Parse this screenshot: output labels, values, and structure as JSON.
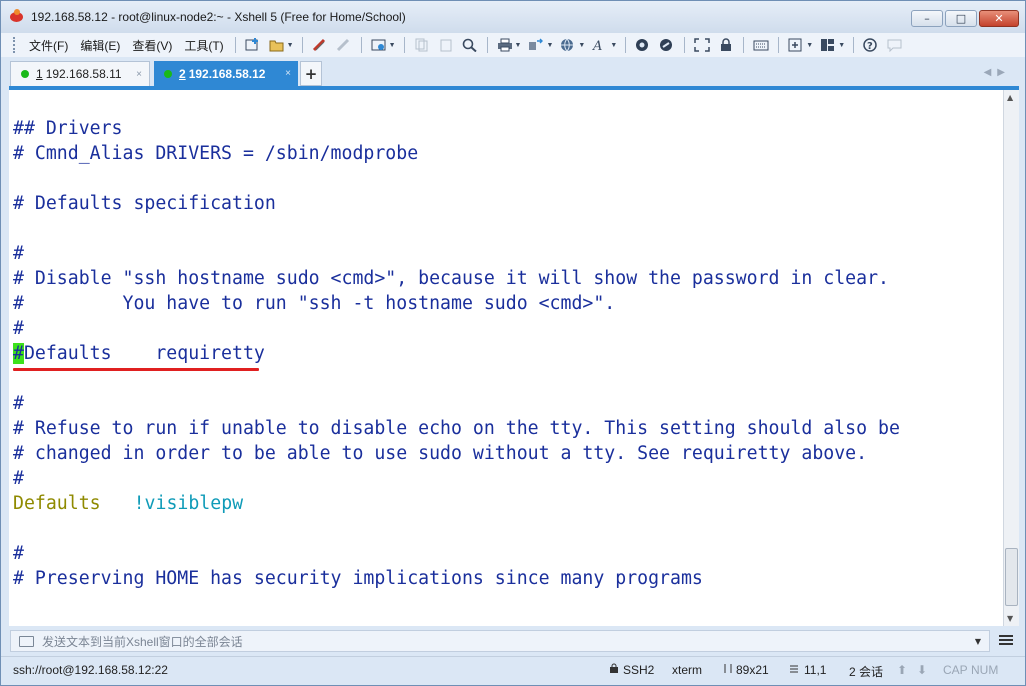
{
  "window": {
    "title": "192.168.58.12 - root@linux-node2:~ - Xshell 5 (Free for Home/School)",
    "minimize_label": "–",
    "maximize_label": "□",
    "close_label": "✕"
  },
  "menu": {
    "file": "文件(F)",
    "edit": "编辑(E)",
    "view": "查看(V)",
    "tools": "工具(T)"
  },
  "tabs": [
    {
      "number": "1",
      "label": "192.168.58.11"
    },
    {
      "number": "2",
      "label": "192.168.58.12"
    }
  ],
  "tab_close_glyph": "×",
  "tab_add_glyph": "+",
  "terminal": {
    "lines": [
      "## Drivers",
      "# Cmnd_Alias DRIVERS = /sbin/modprobe",
      "",
      "# Defaults specification",
      "",
      "#",
      "# Disable \"ssh hostname sudo <cmd>\", because it will show the password in clear.",
      "#         You have to run \"ssh -t hostname sudo <cmd>\".",
      "#",
      "#",
      "Defaults    requiretty",
      "",
      "#",
      "# Refuse to run if unable to disable echo on the tty. This setting should also be",
      "# changed in order to be able to use sudo without a tty. See requiretty above.",
      "#",
      "Defaults",
      "!visiblepw",
      "",
      "#",
      "# Preserving HOME has security implications since many programs"
    ]
  },
  "compose": {
    "placeholder": "发送文本到当前Xshell窗口的全部会话"
  },
  "status": {
    "connection": "ssh://root@192.168.58.12:22",
    "protocol": "SSH2",
    "terminal_type": "xterm",
    "size": "89x21",
    "cursor_pos": "11,1",
    "sessions": "2 会话",
    "caps": "CAP",
    "num": "NUM"
  },
  "colors": {
    "comment": "#1a2f9c",
    "keyword": "#8f8a00",
    "value": "#0f9bb8",
    "cursor": "#3de21b",
    "active_tab": "#2f88d4",
    "annotation_underline": "#e02020"
  },
  "icons": [
    "new-session-icon",
    "open-icon",
    "properties-icon",
    "search-icon",
    "print-icon",
    "globe-icon",
    "font-icon",
    "fullscreen-icon",
    "lock-icon",
    "keyboard-icon",
    "layout-icon",
    "help-icon"
  ]
}
